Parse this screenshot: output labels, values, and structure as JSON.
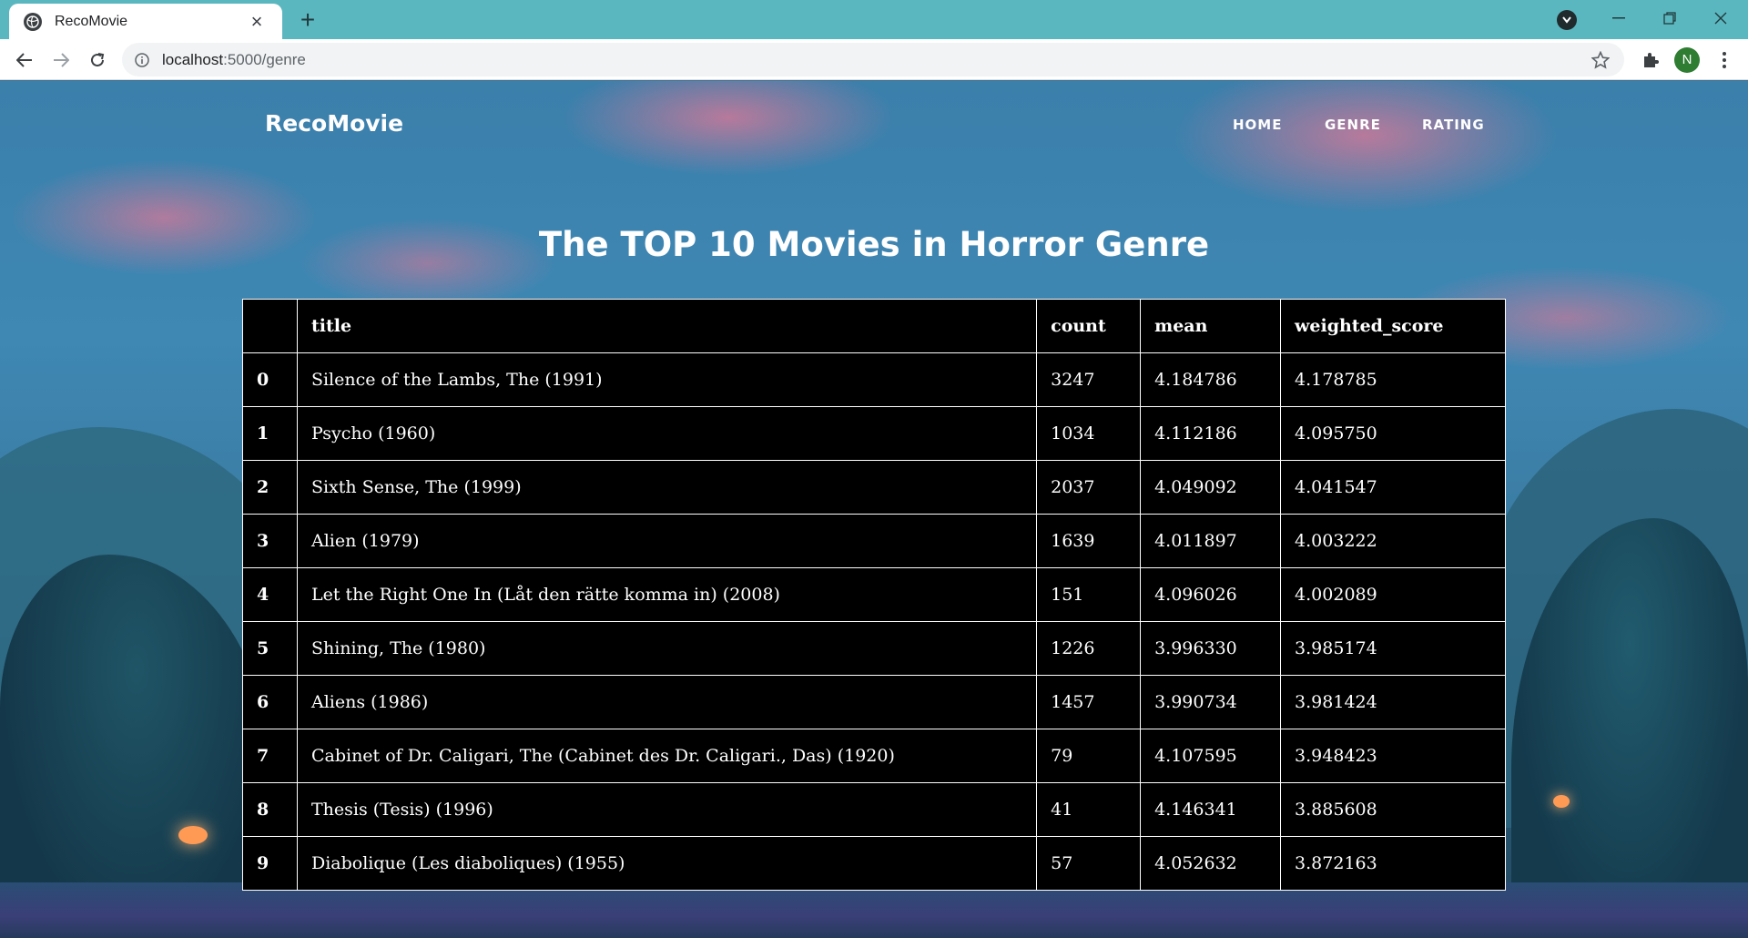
{
  "browser": {
    "tab_title": "RecoMovie",
    "url_host": "localhost",
    "url_path": ":5000/genre",
    "profile_initial": "N"
  },
  "site": {
    "brand": "RecoMovie",
    "nav": [
      "HOME",
      "GENRE",
      "RATING"
    ]
  },
  "heading": "The TOP 10 Movies in Horror Genre",
  "table": {
    "columns": [
      "",
      "title",
      "count",
      "mean",
      "weighted_score"
    ],
    "rows": [
      {
        "index": "0",
        "title": "Silence of the Lambs, The (1991)",
        "count": "3247",
        "mean": "4.184786",
        "weighted_score": "4.178785"
      },
      {
        "index": "1",
        "title": "Psycho (1960)",
        "count": "1034",
        "mean": "4.112186",
        "weighted_score": "4.095750"
      },
      {
        "index": "2",
        "title": "Sixth Sense, The (1999)",
        "count": "2037",
        "mean": "4.049092",
        "weighted_score": "4.041547"
      },
      {
        "index": "3",
        "title": "Alien (1979)",
        "count": "1639",
        "mean": "4.011897",
        "weighted_score": "4.003222"
      },
      {
        "index": "4",
        "title": "Let the Right One In (Låt den rätte komma in) (2008)",
        "count": "151",
        "mean": "4.096026",
        "weighted_score": "4.002089"
      },
      {
        "index": "5",
        "title": "Shining, The (1980)",
        "count": "1226",
        "mean": "3.996330",
        "weighted_score": "3.985174"
      },
      {
        "index": "6",
        "title": "Aliens (1986)",
        "count": "1457",
        "mean": "3.990734",
        "weighted_score": "3.981424"
      },
      {
        "index": "7",
        "title": "Cabinet of Dr. Caligari, The (Cabinet des Dr. Caligari., Das) (1920)",
        "count": "79",
        "mean": "4.107595",
        "weighted_score": "3.948423"
      },
      {
        "index": "8",
        "title": "Thesis (Tesis) (1996)",
        "count": "41",
        "mean": "4.146341",
        "weighted_score": "3.885608"
      },
      {
        "index": "9",
        "title": "Diabolique (Les diaboliques) (1955)",
        "count": "57",
        "mean": "4.052632",
        "weighted_score": "3.872163"
      }
    ]
  }
}
